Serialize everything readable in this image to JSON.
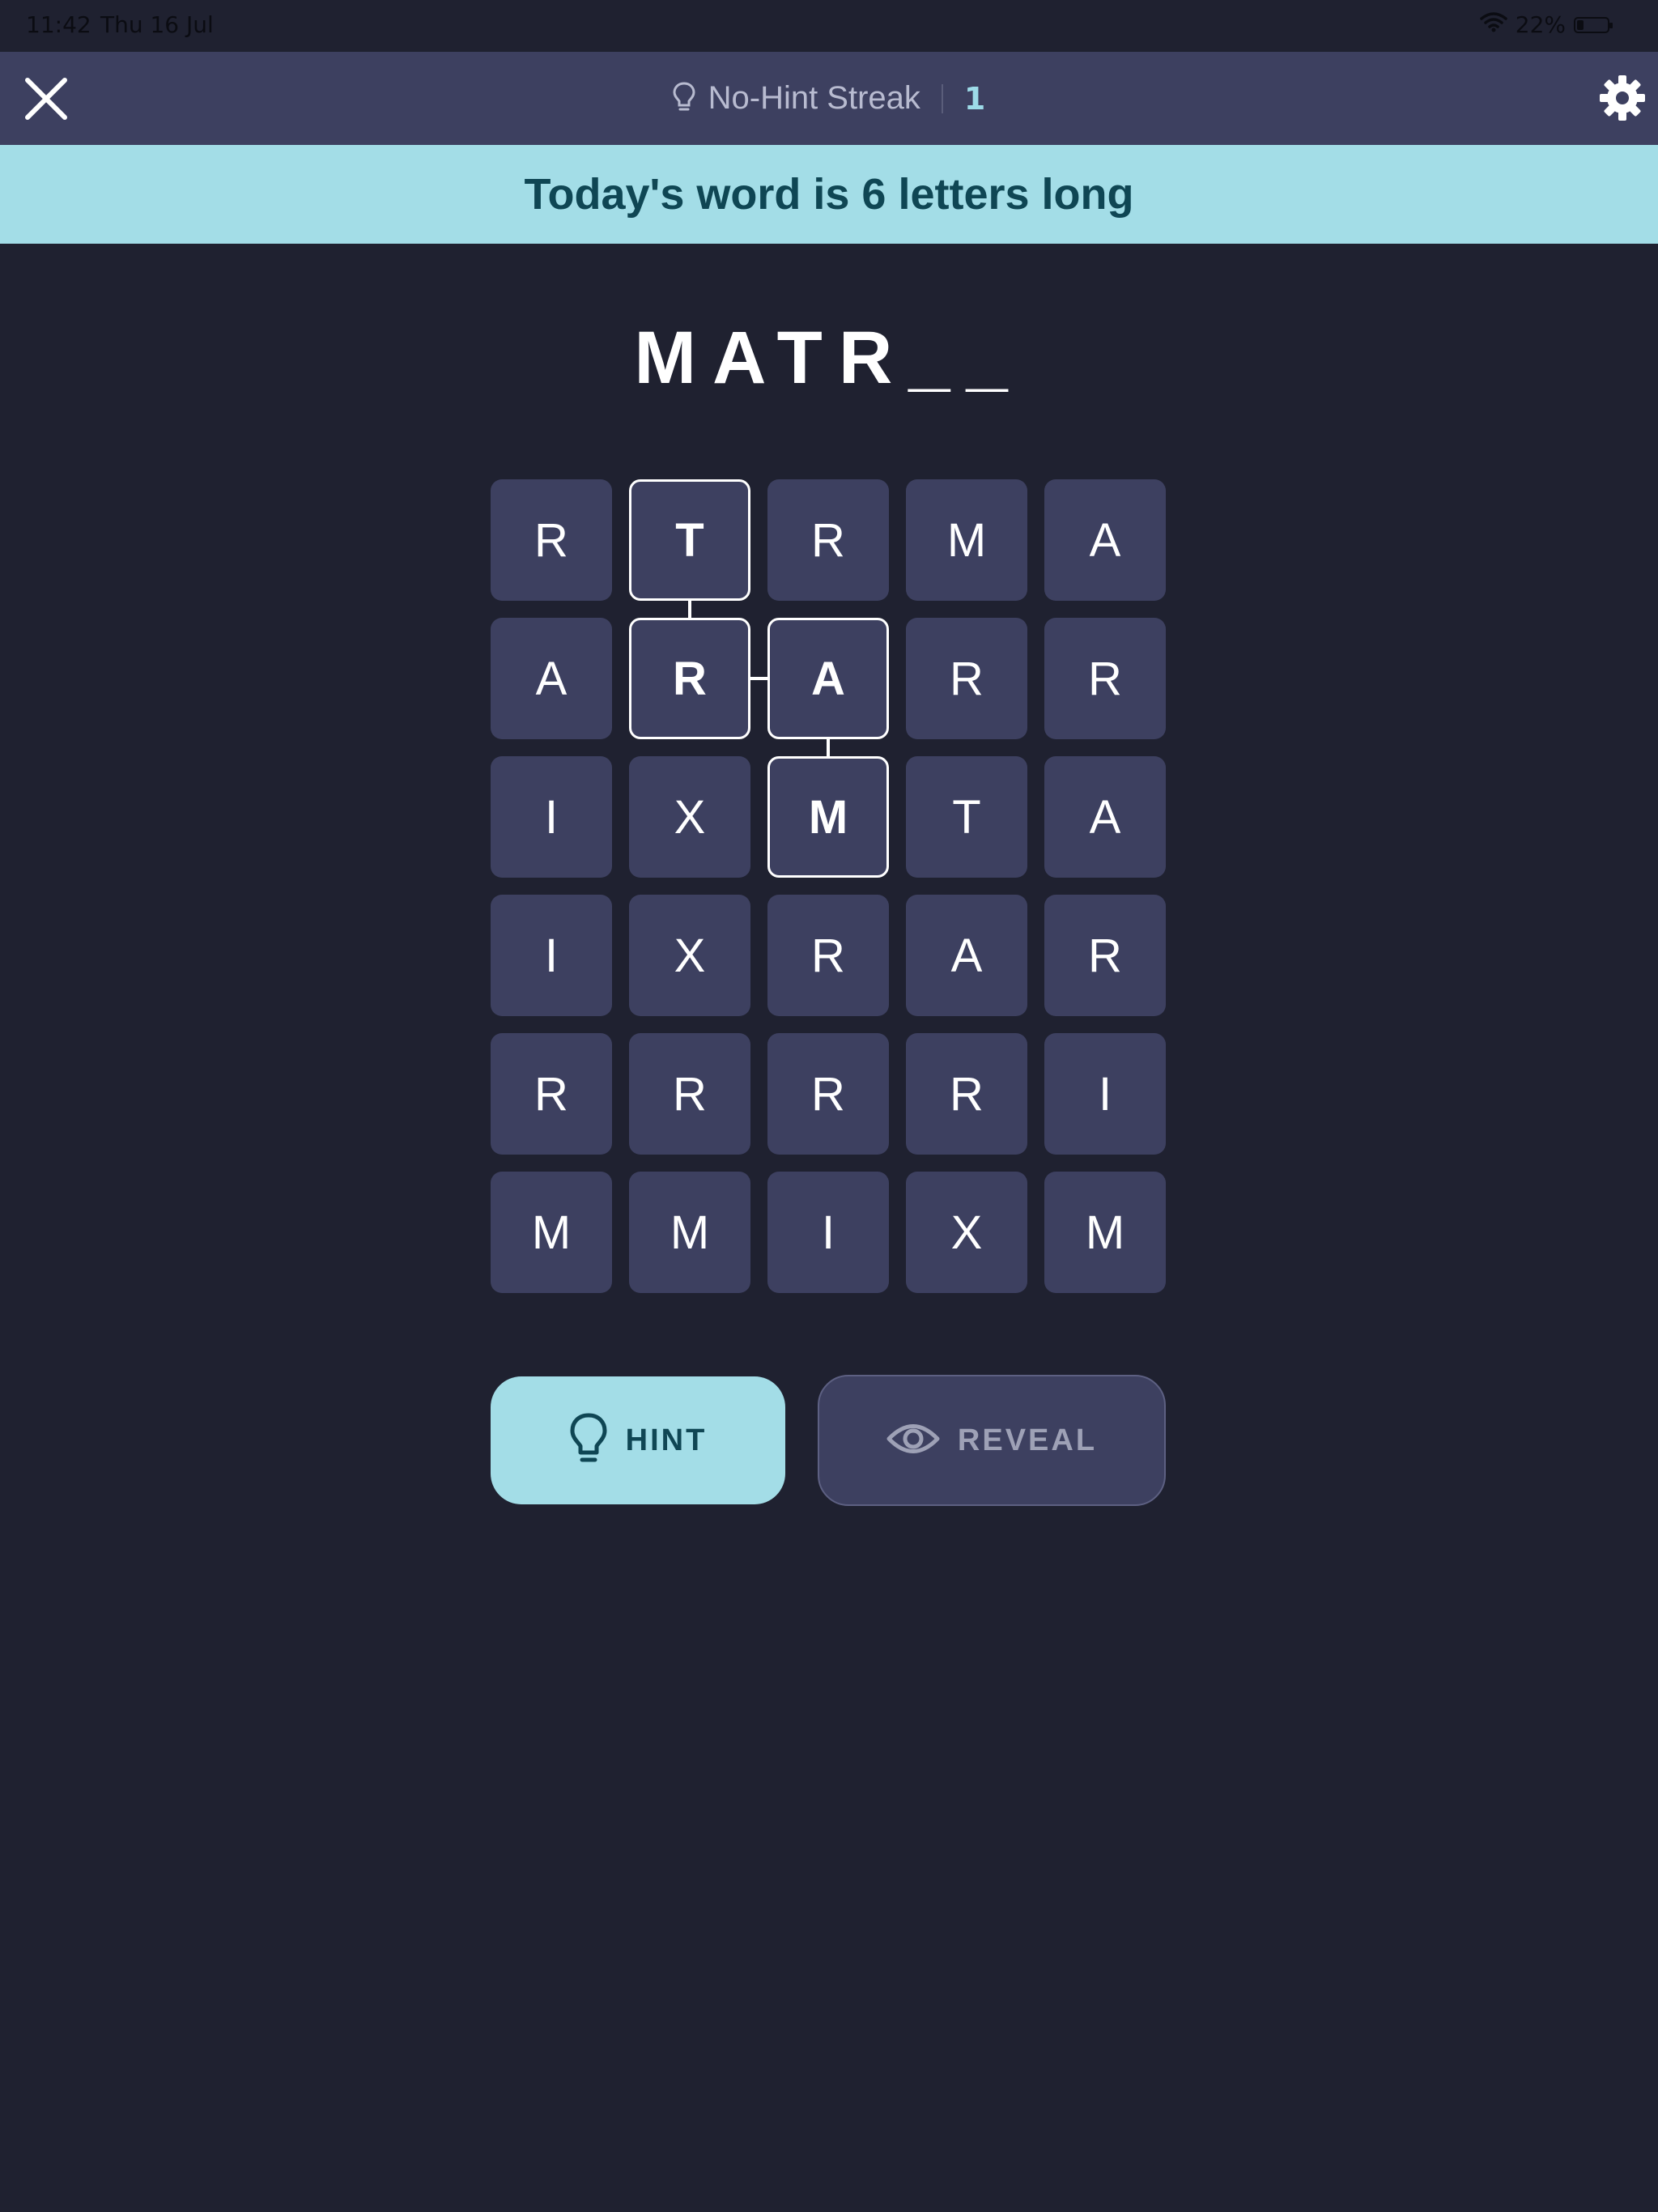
{
  "status_bar": {
    "time": "11:42",
    "date": "Thu 16 Jul",
    "battery": "22%",
    "battery_level": 0.22
  },
  "top_bar": {
    "streak_label": "No-Hint Streak",
    "streak_count": "1"
  },
  "banner": {
    "text": "Today's word is 6 letters long"
  },
  "word_progress": "MATR__",
  "grid": {
    "rows": [
      [
        "R",
        "T",
        "R",
        "M",
        "A"
      ],
      [
        "A",
        "R",
        "A",
        "R",
        "R"
      ],
      [
        "I",
        "X",
        "M",
        "T",
        "A"
      ],
      [
        "I",
        "X",
        "R",
        "A",
        "R"
      ],
      [
        "R",
        "R",
        "R",
        "R",
        "I"
      ],
      [
        "M",
        "M",
        "I",
        "X",
        "M"
      ]
    ],
    "selected_path": [
      [
        2,
        2
      ],
      [
        1,
        2
      ],
      [
        1,
        1
      ],
      [
        0,
        1
      ]
    ]
  },
  "buttons": {
    "hint_label": "HINT",
    "reveal_label": "REVEAL"
  },
  "colors": {
    "background": "#1f2130",
    "tile": "#3d4060",
    "accent": "#a3dde7",
    "accent_text": "#0f4654"
  }
}
